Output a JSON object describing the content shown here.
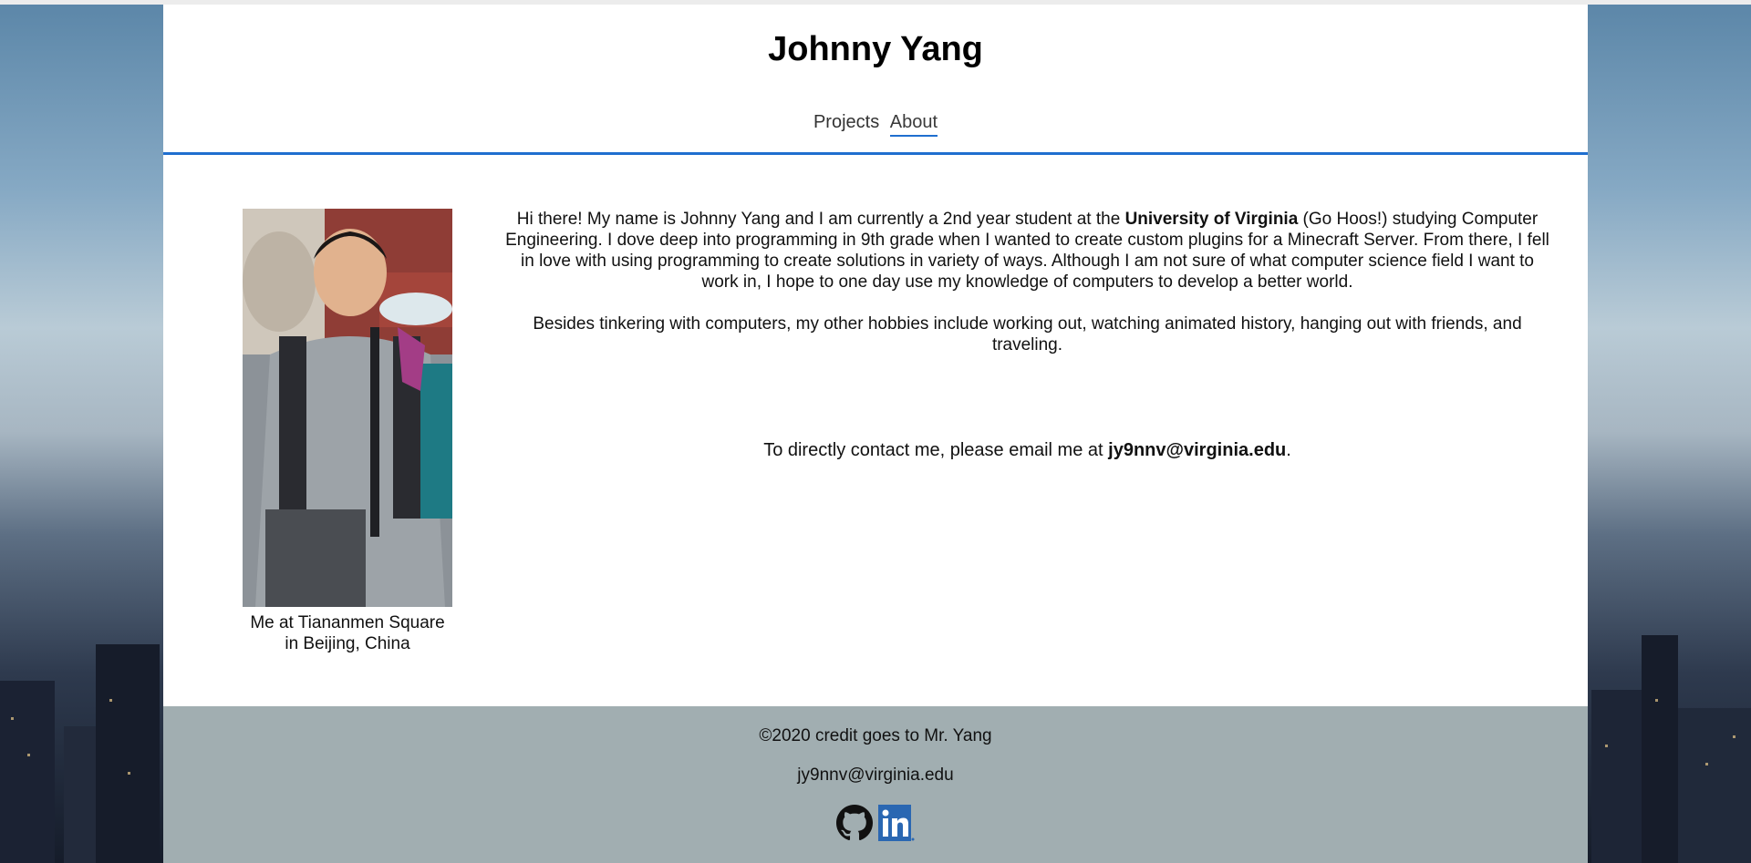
{
  "header": {
    "title": "Johnny Yang",
    "nav": [
      {
        "label": "Projects"
      },
      {
        "label": "About",
        "active": true
      }
    ]
  },
  "profile": {
    "caption_line1": "Me at Tiananmen Square",
    "caption_line2": "in Beijing, China"
  },
  "bio": {
    "p1_pre": "Hi there! My name is Johnny Yang and I am currently a 2nd year student at the ",
    "p1_bold": "University of Virginia",
    "p1_post": " (Go Hoos!) studying Computer Engineering. I dove deep into programming in 9th grade when I wanted to create custom plugins for a Minecraft Server. From there, I fell in love with using programming to create solutions in variety of ways. Although I am not sure of what computer science field I want to work in, I hope to one day use my knowledge of computers to develop a better world.",
    "p2": "Besides tinkering with computers, my other hobbies include working out, watching animated history, hanging out with friends, and traveling.",
    "contact_pre": "To directly contact me, please email me at ",
    "contact_email": "jy9nnv@virginia.edu",
    "contact_post": "."
  },
  "footer": {
    "copyright": "©2020 credit goes to Mr. Yang",
    "email": "jy9nnv@virginia.edu",
    "social": [
      {
        "icon": "github-icon"
      },
      {
        "icon": "linkedin-icon"
      }
    ]
  },
  "colors": {
    "accent": "#1f6fcf",
    "footer_bg": "#a1aeb1",
    "linkedin": "#2a67b2"
  }
}
